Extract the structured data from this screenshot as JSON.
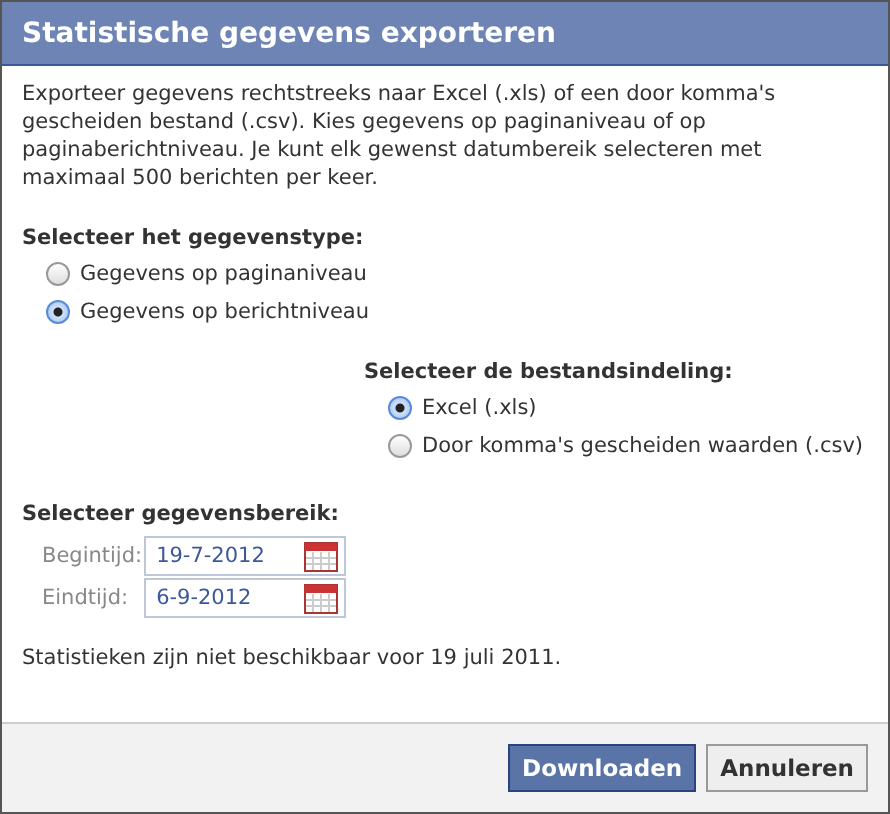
{
  "window": {
    "title": "Statistische gegevens exporteren"
  },
  "intro": "Exporteer gegevens rechtstreeks naar Excel (.xls) of een door komma's gescheiden bestand (.csv). Kies gegevens op paginaniveau of op paginaberichtniveau. Je kunt elk gewenst datumbereik selecteren met maximaal 500 berichten per keer.",
  "data_type": {
    "label": "Selecteer het gegevenstype:",
    "options": [
      {
        "label": "Gegevens op paginaniveau",
        "selected": false
      },
      {
        "label": "Gegevens op berichtniveau",
        "selected": true
      }
    ]
  },
  "file_format": {
    "label": "Selecteer de bestandsindeling:",
    "options": [
      {
        "label": "Excel (.xls)",
        "selected": true
      },
      {
        "label": "Door komma's gescheiden waarden (.csv)",
        "selected": false
      }
    ]
  },
  "range": {
    "label": "Selecteer gegevensbereik:",
    "fields": [
      {
        "label": "Begintijd:",
        "value": "19-7-2012"
      },
      {
        "label": "Eindtijd:",
        "value": "6-9-2012"
      }
    ]
  },
  "note": "Statistieken zijn niet beschikbaar voor 19 juli 2011.",
  "buttons": [
    {
      "label": "Downloaden",
      "kind": "primary"
    },
    {
      "label": "Annuleren",
      "kind": "secondary"
    }
  ]
}
